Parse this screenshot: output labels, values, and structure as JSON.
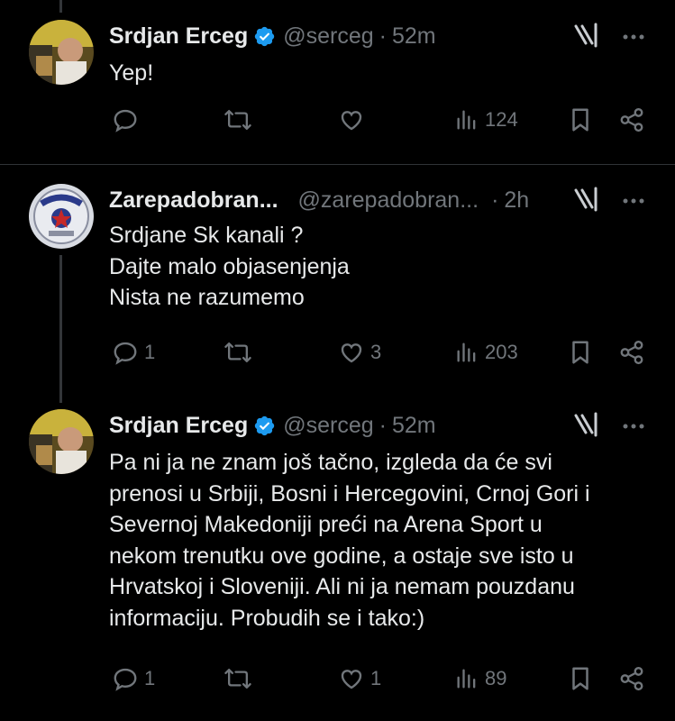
{
  "colors": {
    "background": "#000000",
    "text": "#e7e9ea",
    "muted": "#71767b",
    "verified": "#1d9bf0",
    "divider": "#2f3336"
  },
  "tweets": [
    {
      "author": "Srdjan Erceg",
      "verified": true,
      "handle": "@serceg",
      "separator": "·",
      "time": "52m",
      "lines": [
        "Yep!"
      ],
      "replies": "",
      "reposts": "",
      "likes": "",
      "views": "124"
    },
    {
      "author": "Zarepadobran...",
      "verified": false,
      "handle": "@zarepadobran...",
      "separator": "·",
      "time": "2h",
      "lines": [
        "Srdjane Sk kanali ?",
        "Dajte malo objasenjenja",
        "Nista ne razumemo"
      ],
      "replies": "1",
      "reposts": "",
      "likes": "3",
      "views": "203"
    },
    {
      "author": "Srdjan Erceg",
      "verified": true,
      "handle": "@serceg",
      "separator": "·",
      "time": "52m",
      "lines": [
        "Pa ni ja ne znam još tačno, izgleda da će svi",
        "prenosi u Srbiji, Bosni i Hercegovini, Crnoj Gori i",
        "Severnoj Makedoniji preći na Arena Sport u",
        "nekom trenutku ove godine, a ostaje sve isto u",
        "Hrvatskoj i Sloveniji. Ali ni ja nemam pouzdanu",
        "informaciju. Probudih se i tako:)"
      ],
      "replies": "1",
      "reposts": "",
      "likes": "1",
      "views": "89"
    }
  ],
  "icons": {
    "reply": "reply-icon",
    "repost": "repost-icon",
    "like": "like-icon",
    "views": "views-icon",
    "bookmark": "bookmark-icon",
    "share": "share-icon",
    "grok": "grok-icon",
    "more": "more-icon",
    "verified": "verified-badge-icon"
  }
}
